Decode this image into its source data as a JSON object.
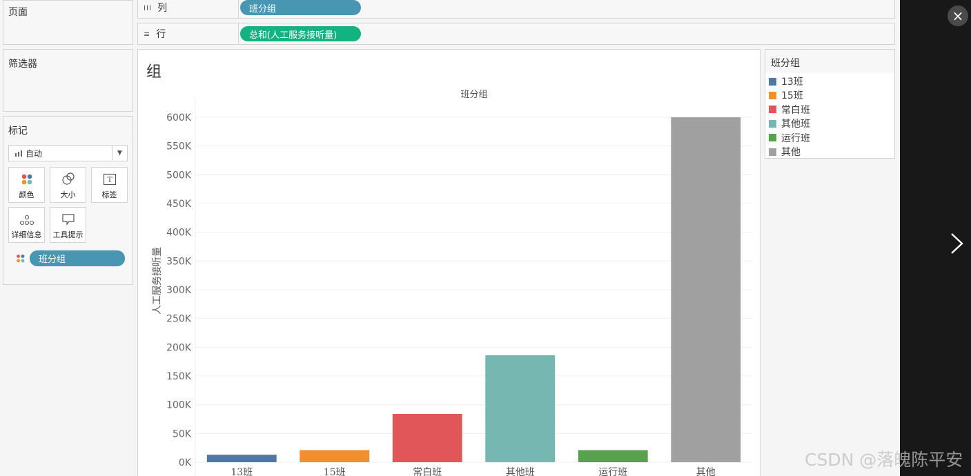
{
  "pages_panel": {
    "title": "页面"
  },
  "filters_panel": {
    "title": "筛选器"
  },
  "marks_panel": {
    "title": "标记",
    "mark_type": "自动",
    "buttons": {
      "color": "颜色",
      "size": "大小",
      "label": "标签",
      "detail": "详细信息",
      "tooltip": "工具提示"
    },
    "color_field": "班分组"
  },
  "columns_shelf": {
    "label": "列",
    "pill": "班分组"
  },
  "rows_shelf": {
    "label": "行",
    "pill": "总和(人工服务接听量)"
  },
  "sheet_title": "组",
  "legend": {
    "title": "班分组",
    "items": [
      {
        "label": "13班",
        "color": "#4e79a7"
      },
      {
        "label": "15班",
        "color": "#f28e2b"
      },
      {
        "label": "常白班",
        "color": "#e15759"
      },
      {
        "label": "其他班",
        "color": "#76b7b2"
      },
      {
        "label": "运行班",
        "color": "#59a14f"
      },
      {
        "label": "其他",
        "color": "#a0a0a0"
      }
    ]
  },
  "chart_data": {
    "type": "bar",
    "title": "",
    "header": "班分组",
    "xlabel": "",
    "ylabel": "人工服务接听量",
    "categories": [
      "13班",
      "15班",
      "常白班",
      "其他班",
      "运行班",
      "其他"
    ],
    "values": [
      13000,
      21000,
      84000,
      186000,
      21000,
      600000
    ],
    "colors": [
      "#4e79a7",
      "#f28e2b",
      "#e15759",
      "#76b7b2",
      "#59a14f",
      "#a0a0a0"
    ],
    "ylim": [
      0,
      600000
    ],
    "yticks": [
      {
        "value": 0,
        "label": "0K"
      },
      {
        "value": 50000,
        "label": "50K"
      },
      {
        "value": 100000,
        "label": "100K"
      },
      {
        "value": 150000,
        "label": "150K"
      },
      {
        "value": 200000,
        "label": "200K"
      },
      {
        "value": 250000,
        "label": "250K"
      },
      {
        "value": 300000,
        "label": "300K"
      },
      {
        "value": 350000,
        "label": "350K"
      },
      {
        "value": 400000,
        "label": "400K"
      },
      {
        "value": 450000,
        "label": "450K"
      },
      {
        "value": 500000,
        "label": "500K"
      },
      {
        "value": 550000,
        "label": "550K"
      },
      {
        "value": 600000,
        "label": "600K"
      }
    ],
    "grid": true
  },
  "overlay": {
    "close_icon": "×",
    "watermark": "CSDN @落魄陈平安"
  }
}
